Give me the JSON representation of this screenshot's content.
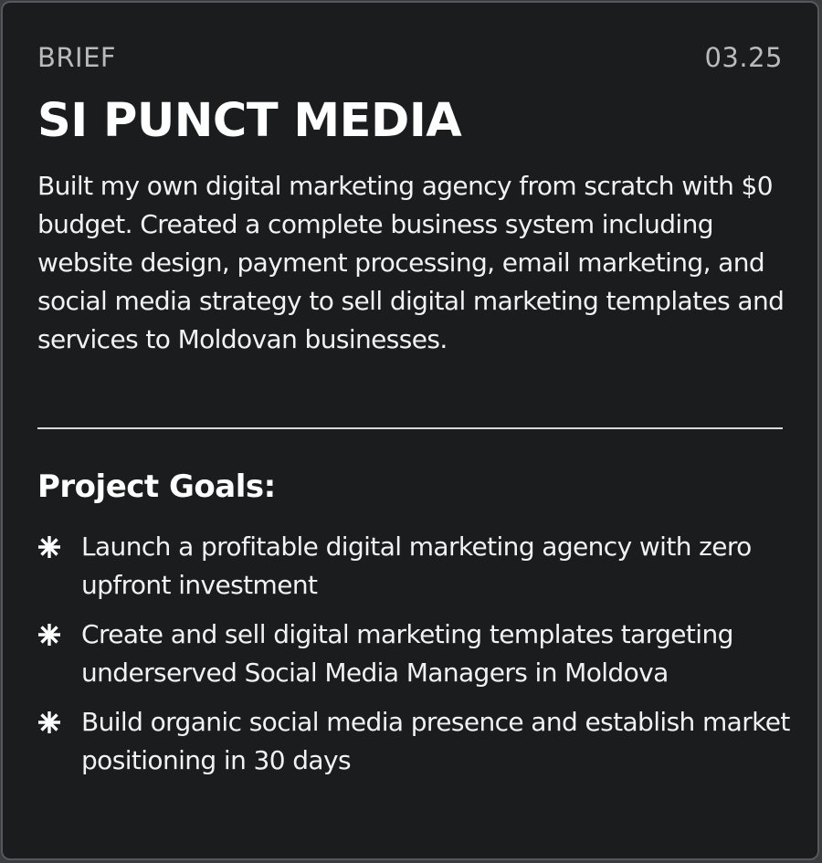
{
  "card": {
    "section_label": "BRIEF",
    "date": "03.25",
    "title": "SI PUNCT MEDIA",
    "description": "Built my own digital marketing agency from scratch with $0 budget. Created a complete business system including website design, payment processing, email marketing, and social media strategy to sell digital marketing templates and services to Moldovan businesses.",
    "goals_heading": "Project Goals:",
    "goals": [
      {
        "icon": "asterisk-icon",
        "text": "Launch a profitable digital marketing agency with zero upfront investment"
      },
      {
        "icon": "asterisk-icon",
        "text": "Create and sell digital marketing templates targeting underserved Social Media Managers in Moldova"
      },
      {
        "icon": "asterisk-icon",
        "text": "Build organic social media presence and establish market positioning in 30 days"
      }
    ]
  },
  "colors": {
    "card_background": "#1b1c1e",
    "card_border": "#55585c",
    "text_primary": "#ffffff",
    "text_muted": "#b8babd",
    "divider": "#d9d9d9"
  }
}
